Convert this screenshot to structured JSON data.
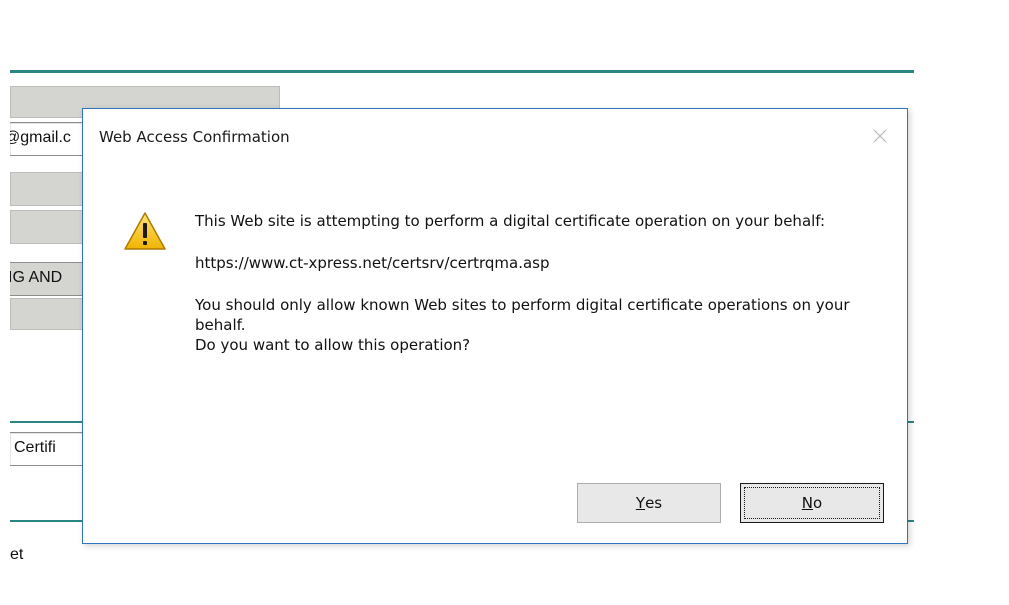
{
  "background": {
    "fragments": {
      "email": "@gmail.c",
      "business": "IG AND",
      "certificate": "i Certifi",
      "footer": "et"
    }
  },
  "dialog": {
    "title": "Web Access Confirmation",
    "close_icon": "close-icon",
    "warning_icon": "warning-icon",
    "message_line1": "This Web site is attempting to perform a digital certificate operation on your behalf:",
    "url": "https://www.ct-xpress.net/certsrv/certrqma.asp",
    "advice": "You should only allow known Web sites to perform digital certificate operations on your behalf.",
    "question": "Do you want to allow this operation?",
    "buttons": {
      "yes": {
        "first": "Y",
        "rest": "es"
      },
      "no": {
        "first": "N",
        "rest": "o"
      }
    }
  },
  "colors": {
    "accent_rule": "#2b8583",
    "dialog_border": "#2f74c0",
    "warning_fill": "#f5c518"
  }
}
